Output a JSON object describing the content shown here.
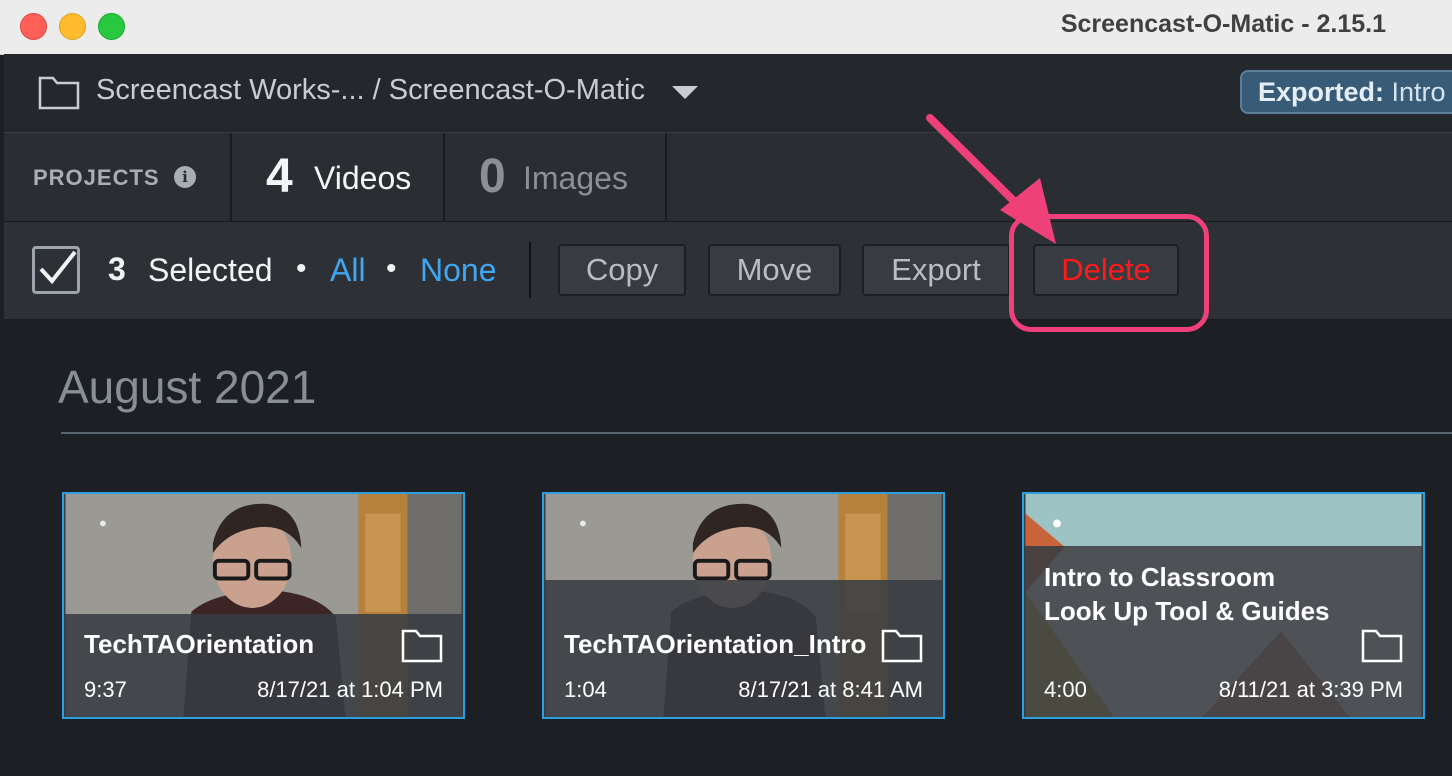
{
  "window": {
    "title": "Screencast-O-Matic - 2.15.1"
  },
  "path": {
    "text": "Screencast Works-... / Screencast-O-Matic",
    "exported_label": "Exported:",
    "exported_value": "Intro"
  },
  "tabs": {
    "projects_label": "PROJECTS",
    "videos_count": "4",
    "videos_label": "Videos",
    "images_count": "0",
    "images_label": "Images"
  },
  "selection": {
    "count": "3",
    "label": "Selected",
    "separator": "•",
    "all": "All",
    "none": "None",
    "copy": "Copy",
    "move": "Move",
    "export": "Export",
    "delete": "Delete"
  },
  "month": "August 2021",
  "cards": [
    {
      "title": "TechTAOrientation",
      "duration": "9:37",
      "date": "8/17/21 at 1:04 PM"
    },
    {
      "title": "TechTAOrientation_Intro",
      "duration": "1:04",
      "date": "8/17/21 at 8:41 AM"
    },
    {
      "title": "Intro to Classroom Look Up Tool & Guides",
      "duration": "4:00",
      "date": "8/11/21 at 3:39 PM"
    }
  ],
  "colors": {
    "accent_link": "#41a5ef",
    "delete": "#ff1a1a",
    "highlight": "#f0407a",
    "selected_border": "#2d9fe0"
  }
}
